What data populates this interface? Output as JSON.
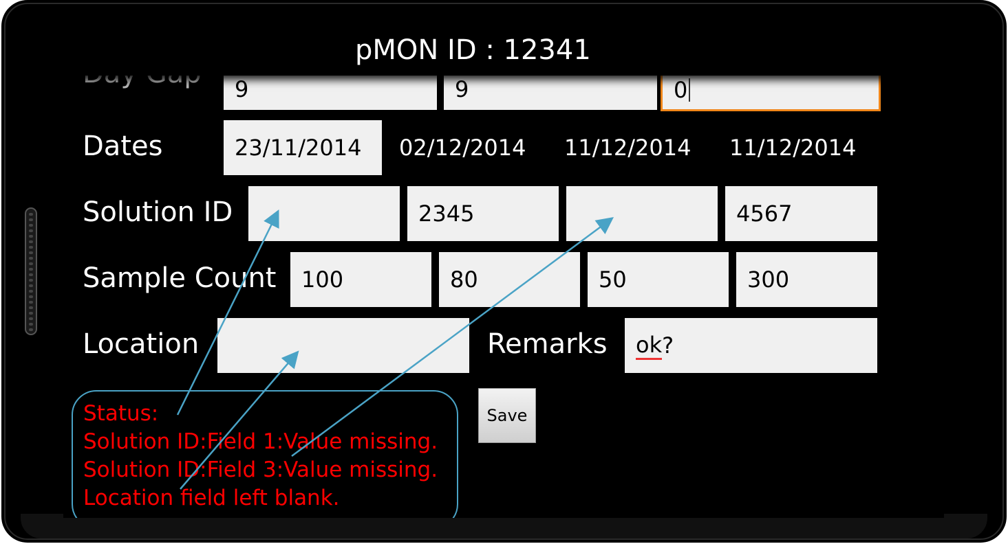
{
  "app": {
    "title": "pMON ID :  12341"
  },
  "day_gap": {
    "label": "Day Gap",
    "values": [
      "9",
      "9",
      "0"
    ]
  },
  "dates": {
    "label": "Dates",
    "values": [
      "23/11/2014",
      "02/12/2014",
      "11/12/2014",
      "11/12/2014"
    ]
  },
  "solution_id": {
    "label": "Solution ID",
    "values": [
      "",
      "2345",
      "",
      "4567"
    ]
  },
  "sample_count": {
    "label": "Sample Count",
    "values": [
      "100",
      "80",
      "50",
      "300"
    ]
  },
  "location": {
    "label": "Location",
    "value": ""
  },
  "remarks": {
    "label": "Remarks",
    "value": "ok",
    "suffix": "?"
  },
  "save_label": "Save",
  "status": {
    "lines": [
      "Status:",
      "Solution ID:Field 1:Value missing.",
      "Solution ID:Field 3:Value missing.",
      "Location field left blank."
    ]
  },
  "colors": {
    "accent": "#f0861a",
    "status_text": "#ff0000",
    "callout": "#4aa3c6"
  },
  "icons": {
    "overflow": "overflow-menu-icon",
    "recents": "recents-icon",
    "home": "home-icon",
    "back": "back-icon"
  }
}
